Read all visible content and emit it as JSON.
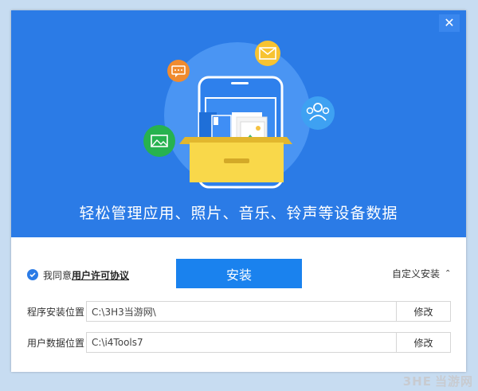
{
  "window": {
    "close_glyph": "✕"
  },
  "banner": {
    "slogan": "轻松管理应用、照片、音乐、铃声等设备数据",
    "background_color": "#2b7be6",
    "icons": [
      "chat-icon",
      "mail-icon",
      "contacts-icon",
      "photo-icon",
      "phone-icon",
      "drawer-icon"
    ]
  },
  "agreement": {
    "prefix": "我同意",
    "link_text": "用户许可协议",
    "checked": true
  },
  "install_button": {
    "label": "安装",
    "color": "#1a82ee"
  },
  "custom_install": {
    "label": "自定义安装",
    "chevron": "⌃"
  },
  "install_path": {
    "label": "程序安装位置",
    "value": "C:\\3H3当游网\\",
    "button": "修改"
  },
  "data_path": {
    "label": "用户数据位置",
    "value": "C:\\i4Tools7",
    "button": "修改"
  },
  "watermark": {
    "logo_text": "3HE",
    "site_text": "当游网"
  }
}
